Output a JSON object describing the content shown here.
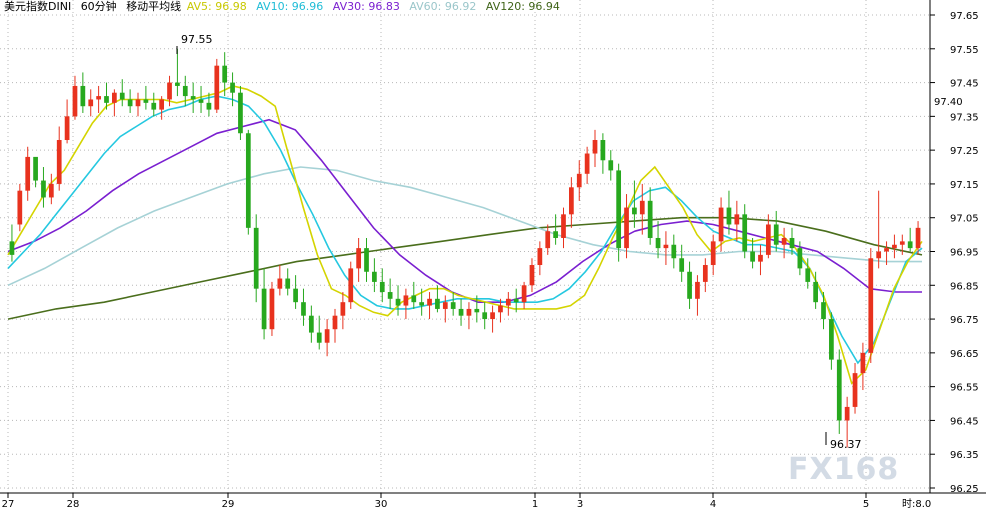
{
  "header": {
    "instrument": "美元指数DINI",
    "period": "60分钟",
    "indicator": "移动平均线"
  },
  "legend": [
    {
      "label": "AV5: 96.98",
      "color": "#d4d400"
    },
    {
      "label": "AV10: 96.96",
      "color": "#25c8e0"
    },
    {
      "label": "AV30: 96.83",
      "color": "#7a1fd0"
    },
    {
      "label": "AV60: 96.92",
      "color": "#a6d2d6"
    },
    {
      "label": "AV120: 96.94",
      "color": "#4a6e1c"
    }
  ],
  "watermark": "FX168",
  "annotations": {
    "high": "97.55",
    "low": "96.37",
    "current": "97.40"
  },
  "x_axis_unit": "时:8.0",
  "colors": {
    "up": "#e8321e",
    "down": "#27a81e",
    "grid": "#b8b8b8",
    "axis": "#000000"
  },
  "chart_data": {
    "type": "candlestick",
    "ylim": [
      96.25,
      97.7
    ],
    "y_ticks": [
      "97.65",
      "97.55",
      "97.45",
      "97.35",
      "97.25",
      "97.15",
      "97.05",
      "96.95",
      "96.85",
      "96.75",
      "96.65",
      "96.55",
      "96.45",
      "96.35",
      "96.25"
    ],
    "x_labels": [
      "27",
      "28",
      "29",
      "30",
      "1",
      "3",
      "4",
      "5"
    ],
    "series": [
      {
        "name": "AV5",
        "value": 96.98
      },
      {
        "name": "AV10",
        "value": 96.96
      },
      {
        "name": "AV30",
        "value": 96.83
      },
      {
        "name": "AV60",
        "value": 96.92
      },
      {
        "name": "AV120",
        "value": 96.94
      }
    ],
    "candles": [
      [
        96.98,
        97.03,
        96.92,
        96.94
      ],
      [
        97.03,
        97.15,
        97.01,
        97.13
      ],
      [
        97.13,
        97.26,
        97.1,
        97.23
      ],
      [
        97.23,
        97.22,
        97.14,
        97.16
      ],
      [
        97.16,
        97.2,
        97.08,
        97.11
      ],
      [
        97.11,
        97.18,
        97.09,
        97.15
      ],
      [
        97.15,
        97.32,
        97.13,
        97.28
      ],
      [
        97.28,
        97.4,
        97.27,
        97.35
      ],
      [
        97.35,
        97.47,
        97.34,
        97.44
      ],
      [
        97.44,
        97.48,
        97.36,
        97.38
      ],
      [
        97.38,
        97.43,
        97.35,
        97.4
      ],
      [
        97.4,
        97.44,
        97.36,
        97.41
      ],
      [
        97.41,
        97.45,
        97.37,
        97.39
      ],
      [
        97.39,
        97.43,
        97.35,
        97.42
      ],
      [
        97.42,
        97.46,
        97.38,
        97.4
      ],
      [
        97.4,
        97.43,
        97.36,
        97.38
      ],
      [
        97.38,
        97.42,
        97.35,
        97.4
      ],
      [
        97.4,
        97.44,
        97.37,
        97.39
      ],
      [
        97.39,
        97.42,
        97.35,
        97.37
      ],
      [
        97.37,
        97.41,
        97.34,
        97.4
      ],
      [
        97.4,
        97.47,
        97.38,
        97.45
      ],
      [
        97.45,
        97.55,
        97.41,
        97.44
      ],
      [
        97.44,
        97.47,
        97.38,
        97.41
      ],
      [
        97.41,
        97.45,
        97.36,
        97.4
      ],
      [
        97.4,
        97.44,
        97.36,
        97.39
      ],
      [
        97.39,
        97.42,
        97.35,
        97.37
      ],
      [
        97.37,
        97.52,
        97.36,
        97.5
      ],
      [
        97.5,
        97.54,
        97.41,
        97.45
      ],
      [
        97.45,
        97.48,
        97.38,
        97.42
      ],
      [
        97.42,
        97.44,
        97.28,
        97.3
      ],
      [
        97.3,
        97.31,
        97.0,
        97.02
      ],
      [
        97.02,
        97.06,
        96.8,
        96.84
      ],
      [
        96.84,
        96.9,
        96.69,
        96.72
      ],
      [
        96.72,
        96.86,
        96.7,
        96.84
      ],
      [
        96.84,
        96.91,
        96.82,
        96.87
      ],
      [
        96.87,
        96.9,
        96.82,
        96.84
      ],
      [
        96.84,
        96.88,
        96.78,
        96.8
      ],
      [
        96.8,
        96.84,
        96.73,
        96.76
      ],
      [
        96.76,
        96.79,
        96.68,
        96.71
      ],
      [
        96.71,
        96.76,
        96.66,
        96.68
      ],
      [
        96.68,
        96.75,
        96.64,
        96.72
      ],
      [
        96.72,
        96.78,
        96.68,
        96.76
      ],
      [
        96.76,
        96.83,
        96.72,
        96.8
      ],
      [
        96.8,
        96.92,
        96.78,
        96.9
      ],
      [
        96.9,
        96.99,
        96.86,
        96.96
      ],
      [
        96.96,
        96.99,
        96.86,
        96.89
      ],
      [
        96.89,
        96.93,
        96.83,
        96.86
      ],
      [
        96.86,
        96.9,
        96.8,
        96.83
      ],
      [
        96.83,
        96.87,
        96.78,
        96.81
      ],
      [
        96.81,
        96.85,
        96.76,
        96.79
      ],
      [
        96.79,
        96.84,
        96.75,
        96.82
      ],
      [
        96.82,
        96.86,
        96.78,
        96.8
      ],
      [
        96.8,
        96.84,
        96.76,
        96.79
      ],
      [
        96.79,
        96.83,
        96.75,
        96.81
      ],
      [
        96.81,
        96.85,
        96.77,
        96.78
      ],
      [
        96.78,
        96.82,
        96.74,
        96.8
      ],
      [
        96.8,
        96.83,
        96.76,
        96.78
      ],
      [
        96.78,
        96.81,
        96.73,
        96.76
      ],
      [
        96.76,
        96.8,
        96.72,
        96.78
      ],
      [
        96.78,
        96.82,
        96.74,
        96.77
      ],
      [
        96.77,
        96.8,
        96.72,
        96.75
      ],
      [
        96.75,
        96.79,
        96.71,
        96.77
      ],
      [
        96.77,
        96.81,
        96.74,
        96.79
      ],
      [
        96.79,
        96.83,
        96.76,
        96.81
      ],
      [
        96.81,
        96.84,
        96.77,
        96.8
      ],
      [
        96.8,
        96.86,
        96.78,
        96.85
      ],
      [
        96.85,
        96.93,
        96.83,
        96.91
      ],
      [
        96.91,
        96.98,
        96.88,
        96.96
      ],
      [
        96.96,
        97.03,
        96.94,
        97.01
      ],
      [
        97.01,
        97.06,
        96.97,
        96.99
      ],
      [
        96.99,
        97.08,
        96.96,
        97.06
      ],
      [
        97.06,
        97.17,
        97.02,
        97.14
      ],
      [
        97.14,
        97.22,
        97.1,
        97.18
      ],
      [
        97.18,
        97.26,
        97.15,
        97.24
      ],
      [
        97.24,
        97.31,
        97.2,
        97.28
      ],
      [
        97.28,
        97.3,
        97.18,
        97.22
      ],
      [
        97.22,
        97.25,
        97.16,
        97.19
      ],
      [
        97.19,
        97.21,
        96.92,
        96.96
      ],
      [
        96.96,
        97.12,
        96.93,
        97.08
      ],
      [
        97.08,
        97.16,
        97.02,
        97.06
      ],
      [
        97.06,
        97.15,
        97.0,
        97.1
      ],
      [
        97.1,
        97.14,
        96.97,
        96.99
      ],
      [
        96.99,
        97.04,
        96.93,
        96.96
      ],
      [
        96.96,
        97.01,
        96.91,
        96.97
      ],
      [
        96.97,
        97.0,
        96.9,
        96.93
      ],
      [
        96.93,
        96.97,
        96.86,
        96.89
      ],
      [
        96.89,
        96.92,
        96.78,
        96.81
      ],
      [
        96.81,
        96.88,
        96.76,
        96.86
      ],
      [
        96.86,
        96.93,
        96.83,
        96.91
      ],
      [
        96.91,
        97.0,
        96.88,
        96.98
      ],
      [
        96.98,
        97.11,
        96.95,
        97.08
      ],
      [
        97.08,
        97.13,
        97.0,
        97.03
      ],
      [
        97.03,
        97.1,
        96.98,
        97.06
      ],
      [
        97.06,
        97.09,
        96.93,
        96.95
      ],
      [
        96.95,
        96.99,
        96.9,
        96.92
      ],
      [
        96.92,
        96.97,
        96.88,
        96.94
      ],
      [
        96.94,
        97.06,
        96.93,
        97.03
      ],
      [
        97.03,
        97.07,
        96.95,
        96.97
      ],
      [
        96.97,
        97.02,
        96.93,
        96.99
      ],
      [
        96.99,
        97.02,
        96.94,
        96.96
      ],
      [
        96.96,
        96.98,
        96.88,
        96.9
      ],
      [
        96.9,
        96.93,
        96.84,
        96.86
      ],
      [
        96.86,
        96.89,
        96.78,
        96.8
      ],
      [
        96.8,
        96.83,
        96.72,
        96.75
      ],
      [
        96.75,
        96.77,
        96.6,
        96.63
      ],
      [
        96.63,
        96.66,
        96.41,
        96.45
      ],
      [
        96.45,
        96.52,
        96.37,
        96.49
      ],
      [
        96.49,
        96.62,
        96.47,
        96.59
      ],
      [
        96.59,
        96.68,
        96.54,
        96.65
      ],
      [
        96.65,
        96.96,
        96.62,
        96.93
      ],
      [
        96.93,
        97.13,
        96.9,
        96.95
      ],
      [
        96.95,
        96.98,
        96.91,
        96.96
      ],
      [
        96.96,
        97.0,
        96.93,
        96.97
      ],
      [
        96.97,
        97.0,
        96.94,
        96.98
      ],
      [
        96.98,
        97.02,
        96.95,
        96.96
      ],
      [
        96.96,
        97.04,
        96.94,
        97.02
      ]
    ],
    "moving_averages": {
      "AV5": [
        96.94,
        97.01,
        97.08,
        97.15,
        97.19,
        97.26,
        97.33,
        97.38,
        97.4,
        97.4,
        97.4,
        97.4,
        97.39,
        97.4,
        97.41,
        97.42,
        97.44,
        97.43,
        97.41,
        97.38,
        97.23,
        97.08,
        96.94,
        96.84,
        96.82,
        96.79,
        96.77,
        96.76,
        96.8,
        96.82,
        96.84,
        96.84,
        96.82,
        96.81,
        96.8,
        96.79,
        96.78,
        96.78,
        96.78,
        96.78,
        96.79,
        96.82,
        96.9,
        96.99,
        97.07,
        97.16,
        97.2,
        97.14,
        97.08,
        97.0,
        96.95,
        96.98,
        96.99,
        96.98,
        96.99,
        97.0,
        96.96,
        96.9,
        96.82,
        96.7,
        96.56,
        96.6,
        96.72,
        96.84,
        96.92,
        96.98
      ],
      "AV10": [
        96.9,
        96.95,
        97.0,
        97.06,
        97.12,
        97.18,
        97.24,
        97.29,
        97.32,
        97.35,
        97.37,
        97.38,
        97.4,
        97.41,
        97.4,
        97.38,
        97.33,
        97.25,
        97.15,
        97.06,
        96.96,
        96.88,
        96.82,
        96.79,
        96.78,
        96.78,
        96.79,
        96.8,
        96.81,
        96.81,
        96.81,
        96.8,
        96.8,
        96.8,
        96.81,
        96.84,
        96.89,
        96.95,
        97.03,
        97.1,
        97.13,
        97.14,
        97.1,
        97.05,
        97.01,
        96.99,
        96.97,
        96.97,
        96.96,
        96.95,
        96.9,
        96.8,
        96.7,
        96.62,
        96.68,
        96.8,
        96.92,
        96.96
      ],
      "AV30": [
        96.95,
        96.98,
        97.02,
        97.07,
        97.13,
        97.18,
        97.22,
        97.26,
        97.3,
        97.32,
        97.34,
        97.31,
        97.22,
        97.12,
        97.02,
        96.94,
        96.88,
        96.83,
        96.8,
        96.8,
        96.82,
        96.86,
        96.92,
        96.97,
        97.01,
        97.03,
        97.04,
        97.03,
        97.01,
        96.99,
        96.97,
        96.95,
        96.9,
        96.84,
        96.83,
        96.83
      ],
      "AV60": [
        96.85,
        96.9,
        96.96,
        97.02,
        97.07,
        97.11,
        97.15,
        97.18,
        97.2,
        97.19,
        97.16,
        97.14,
        97.11,
        97.08,
        97.04,
        97.0,
        96.97,
        96.95,
        96.94,
        96.94,
        96.95,
        96.95,
        96.94,
        96.93,
        96.92,
        96.92
      ],
      "AV120": [
        96.75,
        96.78,
        96.8,
        96.83,
        96.86,
        96.89,
        96.92,
        96.94,
        96.96,
        96.98,
        97.0,
        97.02,
        97.03,
        97.04,
        97.05,
        97.05,
        97.04,
        97.01,
        96.97,
        96.94
      ]
    }
  }
}
